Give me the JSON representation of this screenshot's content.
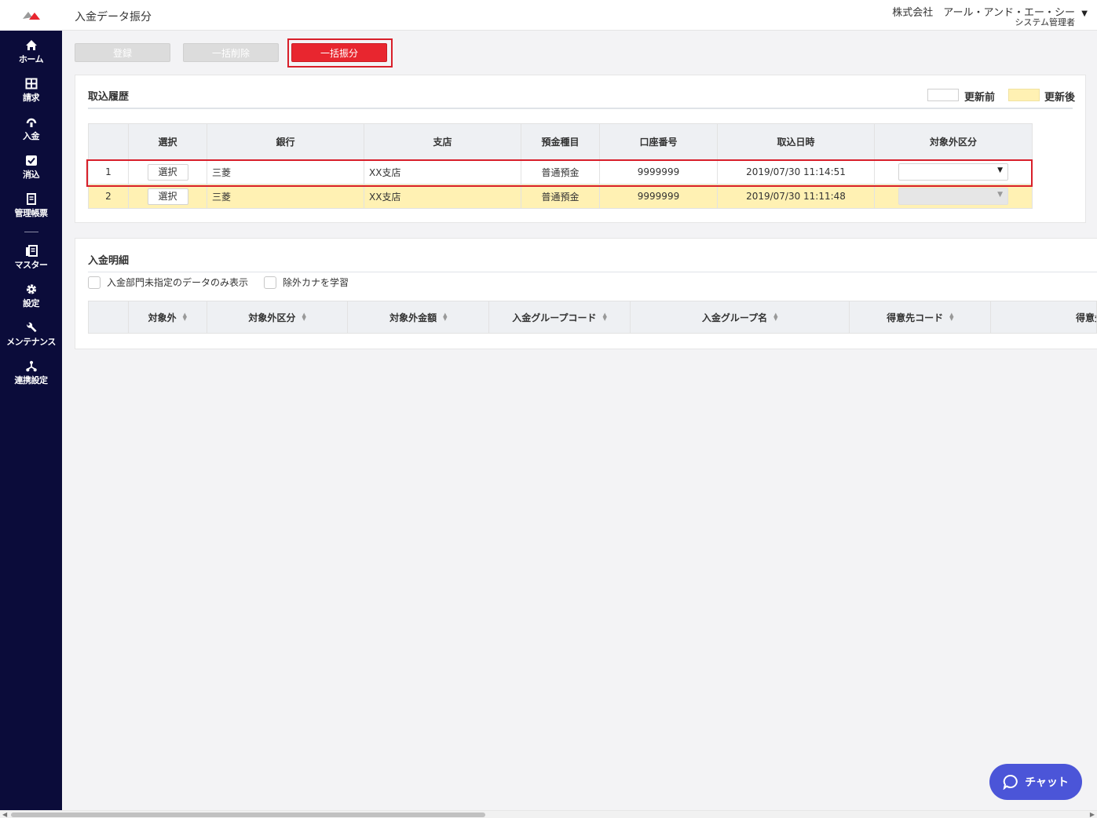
{
  "header": {
    "title": "入金データ振分",
    "company": "株式会社　アール・アンド・エー・シー",
    "user": "システム管理者"
  },
  "sidebar": {
    "items": [
      {
        "label": "ホーム",
        "icon": "home-icon"
      },
      {
        "label": "請求",
        "icon": "invoice-icon"
      },
      {
        "label": "入金",
        "icon": "payment-icon"
      },
      {
        "label": "消込",
        "icon": "check-icon"
      },
      {
        "label": "管理帳票",
        "icon": "report-icon"
      },
      {
        "label": "マスター",
        "icon": "master-icon"
      },
      {
        "label": "設定",
        "icon": "gear-icon"
      },
      {
        "label": "メンテナンス",
        "icon": "wrench-icon"
      },
      {
        "label": "連携設定",
        "icon": "network-icon"
      }
    ]
  },
  "toolbar": {
    "register": "登録",
    "bulk_delete": "一括削除",
    "bulk_assign": "一括振分"
  },
  "import_history": {
    "title": "取込履歴",
    "legend_before": "更新前",
    "legend_after": "更新後",
    "columns": [
      "",
      "選択",
      "銀行",
      "支店",
      "預金種目",
      "口座番号",
      "取込日時",
      "対象外区分"
    ],
    "select_label": "選択",
    "rows": [
      {
        "no": "1",
        "bank": "三菱",
        "branch": "XX支店",
        "type": "普通預金",
        "account": "9999999",
        "datetime": "2019/07/30 11:14:51",
        "state": "before"
      },
      {
        "no": "2",
        "bank": "三菱",
        "branch": "XX支店",
        "type": "普通預金",
        "account": "9999999",
        "datetime": "2019/07/30 11:11:48",
        "state": "after"
      }
    ]
  },
  "payment_details": {
    "title": "入金明細",
    "checkbox_unassigned": "入金部門未指定のデータのみ表示",
    "checkbox_learn": "除外カナを学習",
    "columns": [
      "",
      "対象外",
      "対象外区分",
      "対象外金額",
      "入金グループコード",
      "入金グループ名",
      "得意先コード",
      "得意先"
    ]
  },
  "chat": {
    "label": "チャット"
  },
  "colors": {
    "sidebar": "#0b0c3a",
    "primary": "#e8262f",
    "after_row": "#fff1b3",
    "chat": "#4b55d8"
  }
}
